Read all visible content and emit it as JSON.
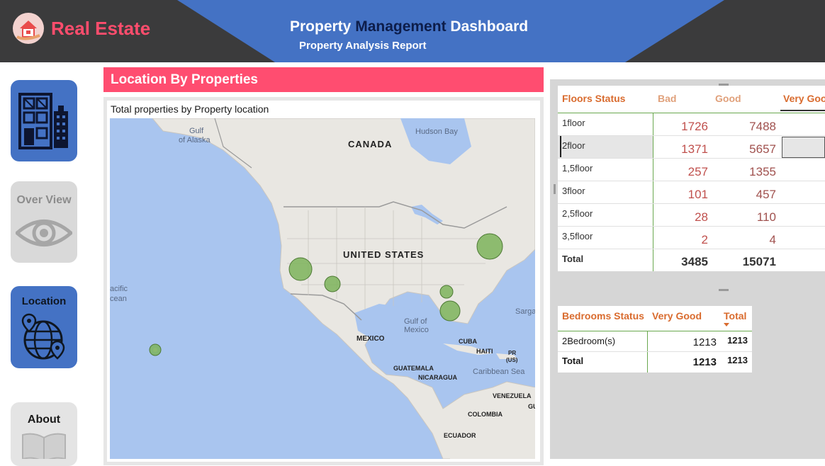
{
  "header": {
    "brand": "Real Estate",
    "title_part1": "Property",
    "title_part2": "Management",
    "title_part3": "Dashboard",
    "subtitle": "Property Analysis Report"
  },
  "nav": {
    "home_icon": "building-icon",
    "overview_label": "Over View",
    "location_label": "Location",
    "about_label": "About"
  },
  "location_section": {
    "title": "Location By Properties",
    "map_caption": "Total properties by Property location",
    "map_labels": {
      "gulf_alaska_1": "Gulf",
      "gulf_alaska_2": "of Alaska",
      "hudson_bay": "Hudson Bay",
      "canada": "CANADA",
      "united_states": "UNITED STATES",
      "pacific_1": "acific",
      "pacific_2": "cean",
      "gulf_mexico_1": "Gulf of",
      "gulf_mexico_2": "Mexico",
      "sargasso": "Sarga",
      "mexico": "MEXICO",
      "cuba": "CUBA",
      "haiti": "HAITI",
      "pr_1": "PR",
      "pr_2": "(US)",
      "caribbean_sea": "Caribbean Sea",
      "guatemala": "GUATEMALA",
      "nicaragua": "NICARAGUA",
      "venezuela": "VENEZUELA",
      "colombia": "COLOMBIA",
      "ecuador": "ECUADOR",
      "gu": "GU"
    }
  },
  "floors_table": {
    "header": "Floors Status",
    "columns": [
      "Bad",
      "Good",
      "Very Goo"
    ],
    "rows": [
      {
        "label": "1floor",
        "bad": "1726",
        "good": "7488"
      },
      {
        "label": "2floor",
        "bad": "1371",
        "good": "5657"
      },
      {
        "label": "1,5floor",
        "bad": "257",
        "good": "1355"
      },
      {
        "label": "3floor",
        "bad": "101",
        "good": "457"
      },
      {
        "label": "2,5floor",
        "bad": "28",
        "good": "110"
      },
      {
        "label": "3,5floor",
        "bad": "2",
        "good": "4"
      }
    ],
    "total": {
      "label": "Total",
      "bad": "3485",
      "good": "15071"
    }
  },
  "bedrooms_table": {
    "header": "Bedrooms Status",
    "col_very_good": "Very Good",
    "col_total": "Total",
    "rows": [
      {
        "label": "2Bedroom(s)",
        "very_good": "1213",
        "total": "1213"
      }
    ],
    "total": {
      "label": "Total",
      "very_good": "1213",
      "total": "1213"
    }
  },
  "colors": {
    "header_dark": "#3b3b3c",
    "header_blue": "#4472c4",
    "accent_pink": "#ff4d70",
    "brand_pink": "#ff4d6d",
    "table_red": "#c0504d",
    "table_orange": "#d96b2e",
    "bubble_green": "#7cb35b"
  }
}
